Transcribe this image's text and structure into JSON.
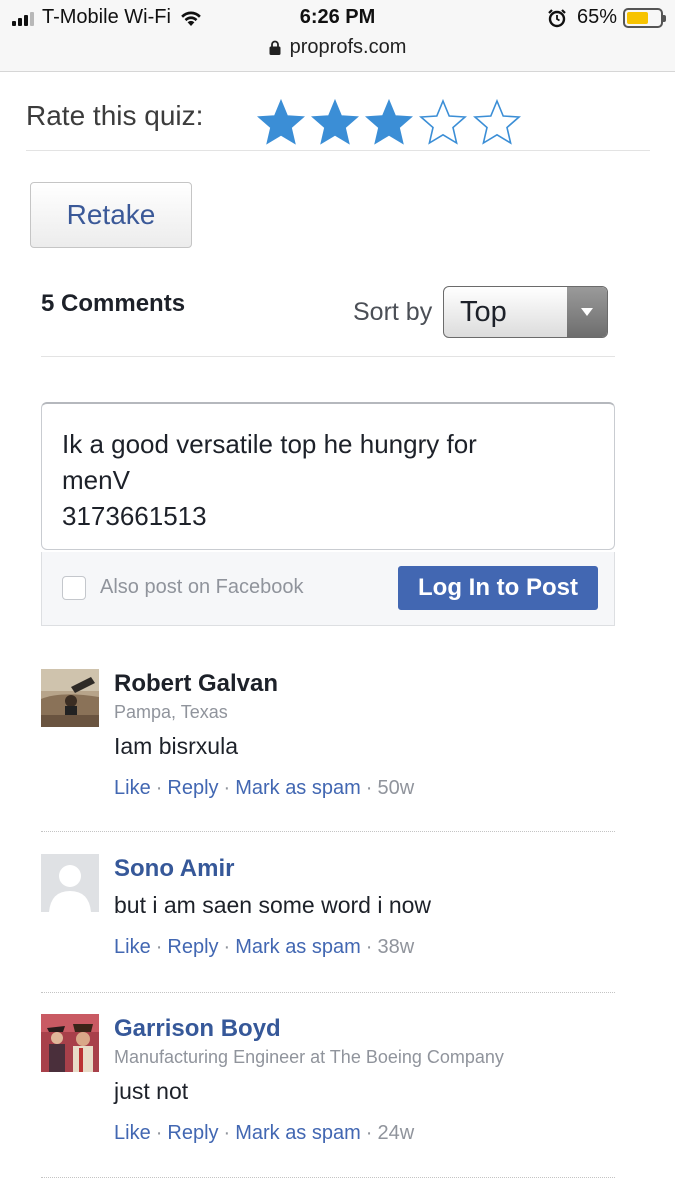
{
  "status_bar": {
    "carrier": "T-Mobile Wi-Fi",
    "time": "6:26 PM",
    "battery_percent": "65%",
    "battery_level": 0.65,
    "url": "proprofs.com",
    "icons": [
      "signal-icon",
      "wifi-icon",
      "alarm-icon",
      "battery-icon",
      "lock-icon"
    ]
  },
  "rating": {
    "label": "Rate this quiz:",
    "value": 3,
    "max": 5,
    "color": "#3b8ed6"
  },
  "retake_label": "Retake",
  "comments_header": {
    "count_label": "5 Comments",
    "sort_label": "Sort by",
    "sort_value": "Top"
  },
  "composer": {
    "text": "Ik a good versatile top he hungry for\nmenV\n3173661513",
    "facebook_label": "Also post on Facebook",
    "post_button": "Log In to Post"
  },
  "comment_actions": {
    "like": "Like",
    "reply": "Reply",
    "spam": "Mark as spam",
    "separator": "·"
  },
  "comments": [
    {
      "name": "Robert Galvan",
      "subtitle": "Pampa, Texas",
      "text": "Iam bisrxula",
      "age": "50w"
    },
    {
      "name": "Sono Amir",
      "subtitle": "",
      "text": "but i am saen some word i now",
      "age": "38w"
    },
    {
      "name": "Garrison Boyd",
      "subtitle": "Manufacturing Engineer at The Boeing Company",
      "text": "just not",
      "age": "24w"
    }
  ],
  "colors": {
    "link_blue": "#4267b2",
    "name_blue": "#365899",
    "star_blue": "#3b8ed6",
    "battery_yellow": "#f7c300"
  }
}
